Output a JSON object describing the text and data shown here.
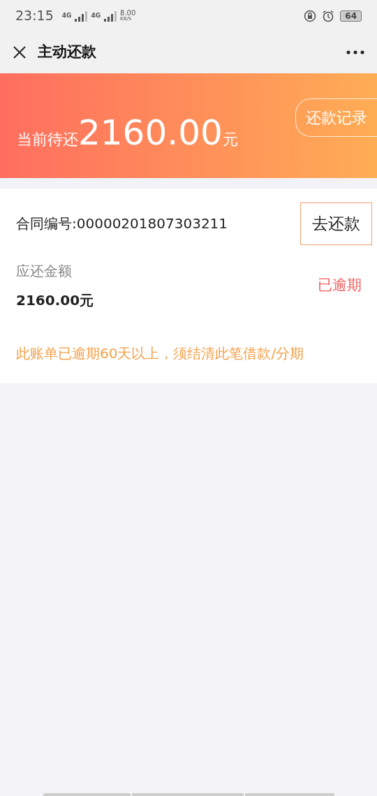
{
  "status_bar": {
    "time": "23:15",
    "network_1": "4G",
    "network_2": "4G",
    "speed": "8.00",
    "speed_unit": "KB/S",
    "battery": "64"
  },
  "header": {
    "title": "主动还款"
  },
  "banner": {
    "label": "当前待还",
    "amount": "2160.00",
    "unit": "元",
    "record_button": "还款记录"
  },
  "bill": {
    "contract": "合同编号:00000201807303211",
    "pay_button": "去还款",
    "due_label": "应还金额",
    "due_amount": "2160.00元",
    "status": "已逾期",
    "warning": "此账单已逾期60天以上，须结清此笔借款/分期"
  }
}
